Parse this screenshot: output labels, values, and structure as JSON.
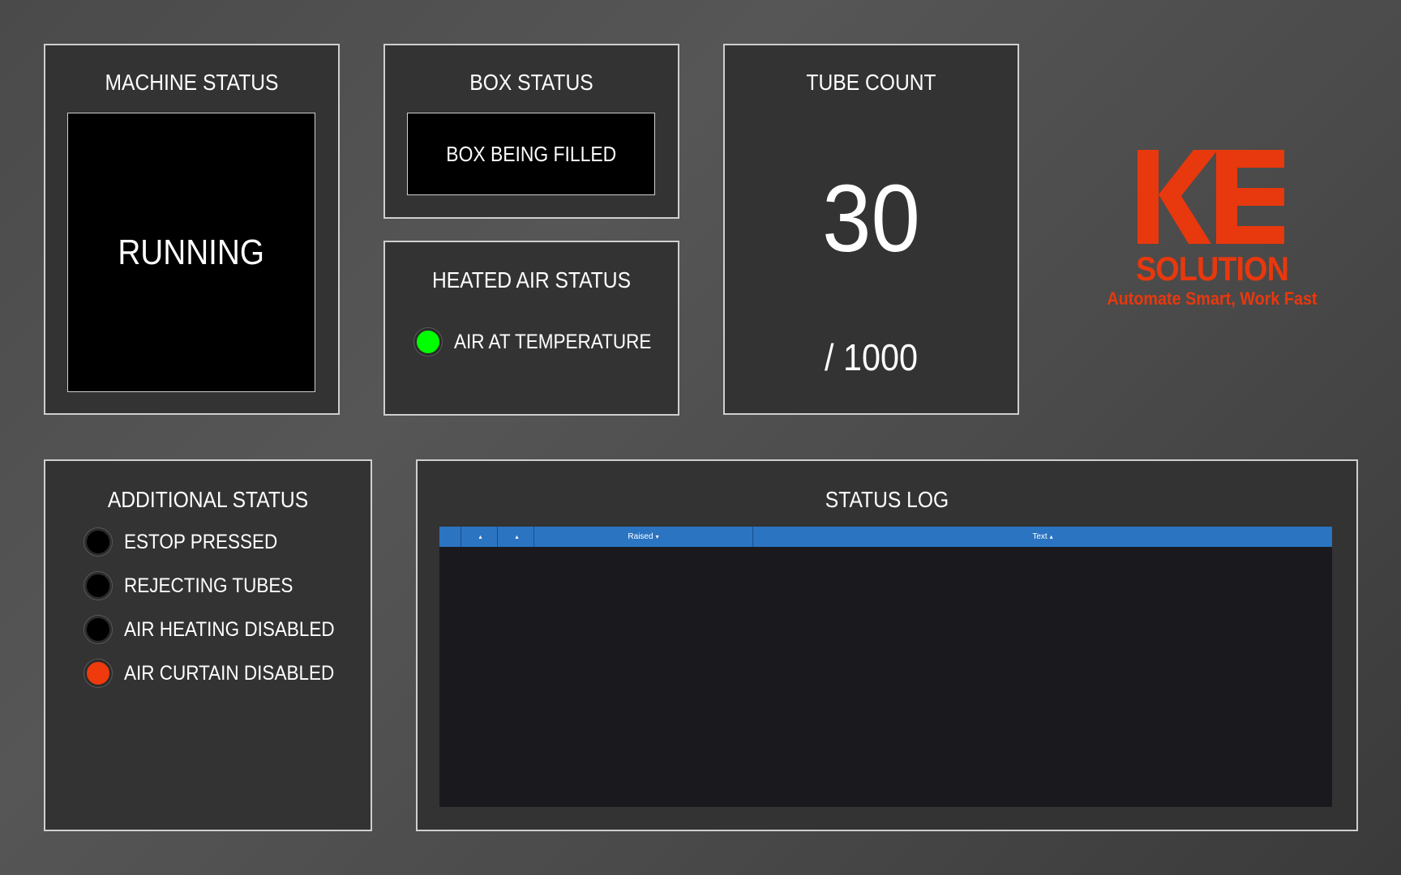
{
  "machine_status": {
    "title": "MACHINE STATUS",
    "value": "RUNNING"
  },
  "box_status": {
    "title": "BOX STATUS",
    "value": "BOX BEING FILLED"
  },
  "heated_air": {
    "title": "HEATED AIR STATUS",
    "label": "AIR AT TEMPERATURE",
    "lamp_color": "#00ff00"
  },
  "tube_count": {
    "title": "TUBE COUNT",
    "count": "30",
    "target": "/ 1000"
  },
  "logo": {
    "mark": "KE",
    "name": "SOLUTION",
    "tagline": "Automate Smart, Work Fast",
    "color": "#e8380d"
  },
  "additional_status": {
    "title": "ADDITIONAL STATUS",
    "items": [
      {
        "label": "ESTOP PRESSED",
        "lamp_color": "#000000"
      },
      {
        "label": "REJECTING TUBES",
        "lamp_color": "#000000"
      },
      {
        "label": "AIR HEATING DISABLED",
        "lamp_color": "#000000"
      },
      {
        "label": "AIR CURTAIN DISABLED",
        "lamp_color": "#ee3a0c"
      }
    ]
  },
  "status_log": {
    "title": "STATUS LOG",
    "columns": [
      "",
      "",
      "",
      "Raised",
      "Text"
    ],
    "sort_icons": [
      "",
      "sort-icon",
      "sort-icon",
      "sort-desc-icon",
      "sort-icon"
    ],
    "rows": []
  },
  "colors": {
    "background": "#4d4d4d",
    "panel": "#333333",
    "border": "#cfcfcf",
    "table_header": "#2a74c2",
    "table_body": "#1a1a1e"
  }
}
